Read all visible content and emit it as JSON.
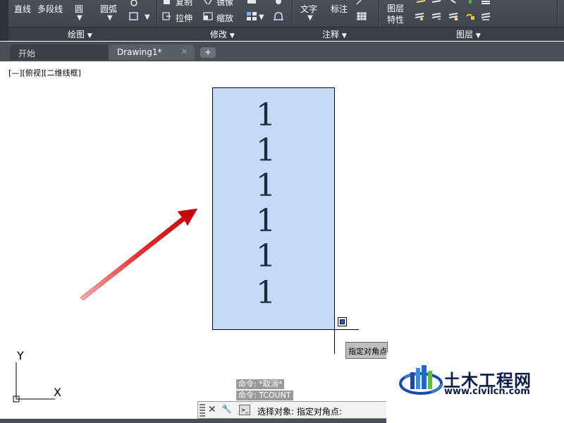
{
  "ribbon": {
    "draw": {
      "line": "直线",
      "polyline": "多段线",
      "circle": "圆",
      "arc": "圆弧"
    },
    "modify": {
      "copy": "复制",
      "mirror": "镜像",
      "stretch": "拉伸",
      "scale": "缩放"
    },
    "annotate": {
      "text": "文字",
      "dimension": "标注"
    },
    "layers": {
      "layer_properties_line1": "图层",
      "layer_properties_line2": "特性"
    },
    "panels": {
      "draw": "绘图",
      "modify": "修改",
      "annotate": "注释",
      "layers": "图层"
    },
    "dropdown_glyph": "▼"
  },
  "tabs": [
    {
      "label": "开始"
    },
    {
      "label": "Drawing1*",
      "close": "✕"
    }
  ],
  "tab_add": "+",
  "viewport_label": "[—][俯视][二维线框]",
  "selected_text_items": [
    "1",
    "1",
    "1",
    "1",
    "1",
    "1"
  ],
  "tooltip": "指定对角点",
  "command": {
    "history": [
      "命令: *取消*",
      "命令: TCOUNT"
    ],
    "close_glyph": "✕",
    "settings_glyph": "🔧",
    "prompt_glyph": ">_",
    "current": "选择对象: 指定对角点:"
  },
  "ucs": {
    "x_label": "X",
    "y_label": "Y"
  },
  "watermark": {
    "name": "土木工程网",
    "url": "www.civilcn.com"
  },
  "colors": {
    "selection": "#c3daf9",
    "arrow": "#e01a1a",
    "ribbon": "#3b4048"
  }
}
